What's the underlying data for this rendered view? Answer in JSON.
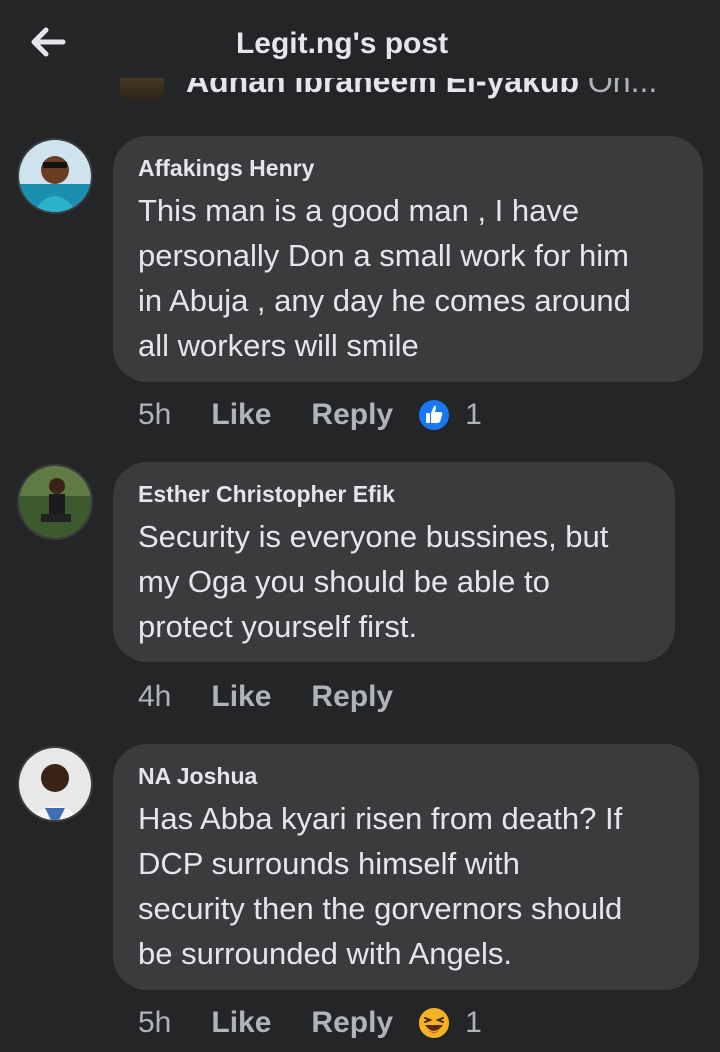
{
  "header": {
    "title": "Legit.ng's post"
  },
  "partial_comment": {
    "author": "Adnan Ibraheem El-yakub",
    "tail": " On..."
  },
  "comments": [
    {
      "author": "Affakings Henry",
      "lines": [
        "This man is a good man , I have",
        "personally Don a small work for him",
        "in Abuja , any day he comes around",
        "all workers will smile"
      ],
      "time": "5h",
      "like": "Like",
      "reply": "Reply",
      "reaction": "like-reaction-icon",
      "reaction_count": "1"
    },
    {
      "author": "Esther Christopher Efik",
      "lines": [
        "Security is everyone bussines, but",
        "my Oga you should be able to",
        "protect yourself first."
      ],
      "time": "4h",
      "like": "Like",
      "reply": "Reply"
    },
    {
      "author": "NA Joshua",
      "lines": [
        "Has Abba kyari risen from death? If",
        "DCP surrounds himself with",
        "security then the gorvernors should",
        "be surrounded with Angels."
      ],
      "time": "5h",
      "like": "Like",
      "reply": "Reply",
      "reaction": "haha-reaction-icon",
      "reaction_count": "1"
    }
  ],
  "colors": {
    "background": "#242526",
    "bubble": "#3a3b3c",
    "text": "#e4e6eb",
    "muted": "#b0b3b8",
    "like_blue": "#1877f2",
    "haha_yellow": "#f7b125"
  }
}
